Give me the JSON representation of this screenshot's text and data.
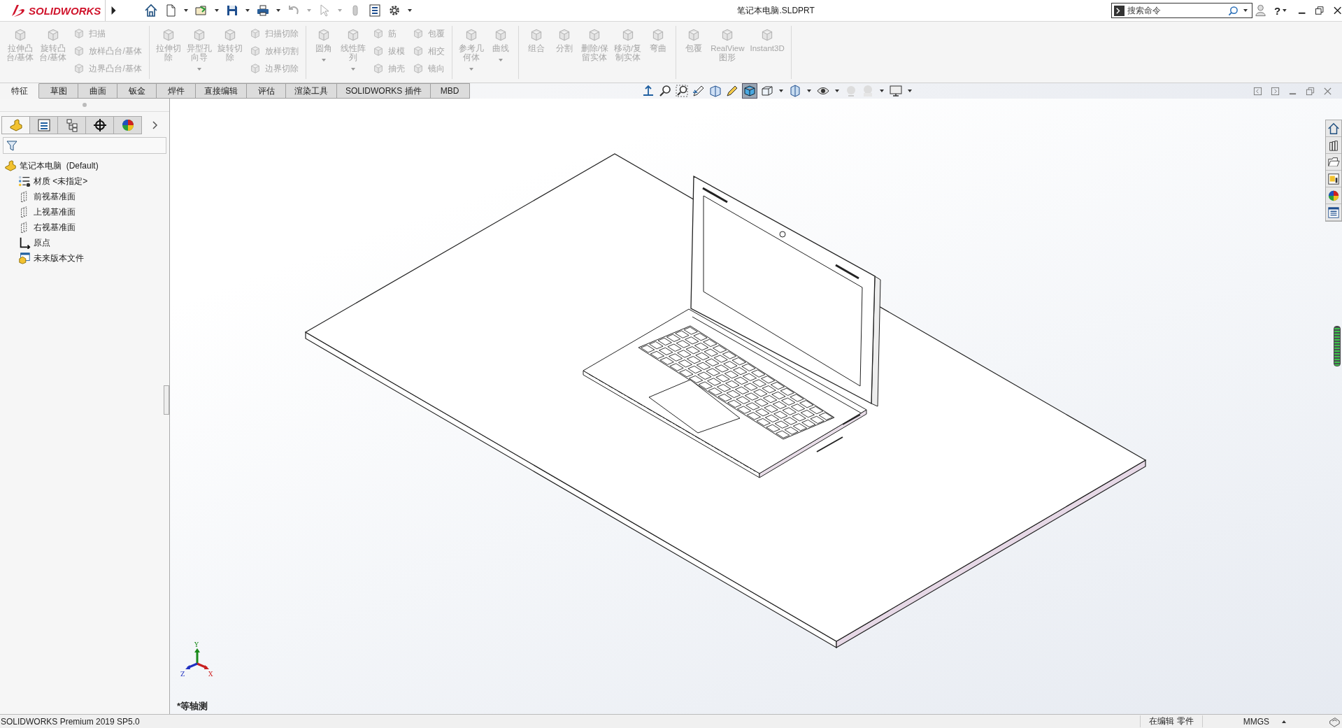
{
  "app": {
    "logo": "SOLIDWORKS",
    "title": "笔记本电脑.SLDPRT",
    "search": {
      "placeholder": "搜索命令"
    },
    "help": "?"
  },
  "ribbon": {
    "groups": [
      {
        "items": [
          {
            "kind": "large",
            "lines": [
              "拉伸凸",
              "台/基体"
            ],
            "disabled": true,
            "menu": false
          },
          {
            "kind": "large",
            "lines": [
              "旋转凸",
              "台/基体"
            ],
            "disabled": true,
            "menu": false
          },
          {
            "kind": "stack",
            "tools": [
              {
                "label": "扫描",
                "disabled": true
              },
              {
                "label": "放样凸台/基体",
                "disabled": true
              },
              {
                "label": "边界凸台/基体",
                "disabled": true
              }
            ]
          }
        ]
      },
      {
        "items": [
          {
            "kind": "large",
            "lines": [
              "拉伸切",
              "除"
            ],
            "disabled": true,
            "menu": false
          },
          {
            "kind": "large",
            "lines": [
              "异型孔",
              "向导"
            ],
            "disabled": true,
            "menu": true
          },
          {
            "kind": "large",
            "lines": [
              "旋转切",
              "除"
            ],
            "disabled": true,
            "menu": false
          },
          {
            "kind": "stack",
            "tools": [
              {
                "label": "扫描切除",
                "disabled": true
              },
              {
                "label": "放样切割",
                "disabled": true
              },
              {
                "label": "边界切除",
                "disabled": true
              }
            ]
          }
        ]
      },
      {
        "items": [
          {
            "kind": "large",
            "lines": [
              "圆角"
            ],
            "disabled": true,
            "menu": true
          },
          {
            "kind": "large",
            "lines": [
              "线性阵",
              "列"
            ],
            "disabled": true,
            "menu": true
          },
          {
            "kind": "stack",
            "tools": [
              {
                "label": "筋",
                "disabled": true
              },
              {
                "label": "拔模",
                "disabled": true
              },
              {
                "label": "抽壳",
                "disabled": true
              }
            ]
          },
          {
            "kind": "stack",
            "tools": [
              {
                "label": "包覆",
                "disabled": true
              },
              {
                "label": "相交",
                "disabled": true
              },
              {
                "label": "镜向",
                "disabled": true
              }
            ]
          }
        ]
      },
      {
        "items": [
          {
            "kind": "large",
            "lines": [
              "参考几",
              "何体"
            ],
            "disabled": true,
            "menu": true
          },
          {
            "kind": "large",
            "lines": [
              "曲线"
            ],
            "disabled": true,
            "menu": true
          }
        ]
      },
      {
        "items": [
          {
            "kind": "large",
            "lines": [
              "组合"
            ],
            "disabled": true,
            "menu": false
          },
          {
            "kind": "large",
            "lines": [
              "分割"
            ],
            "disabled": true,
            "menu": false
          },
          {
            "kind": "large",
            "lines": [
              "删除/保",
              "留实体"
            ],
            "disabled": true,
            "menu": false
          },
          {
            "kind": "large",
            "lines": [
              "移动/复",
              "制实体"
            ],
            "disabled": true,
            "menu": false
          },
          {
            "kind": "large",
            "lines": [
              "弯曲"
            ],
            "disabled": true,
            "menu": false
          }
        ]
      },
      {
        "items": [
          {
            "kind": "large",
            "lines": [
              "包覆"
            ],
            "disabled": true,
            "menu": false
          },
          {
            "kind": "large",
            "lines": [
              "RealView",
              "图形"
            ],
            "disabled": true,
            "menu": false
          },
          {
            "kind": "large",
            "lines": [
              "Instant3D"
            ],
            "disabled": true,
            "menu": false
          }
        ]
      }
    ]
  },
  "tabs": [
    {
      "label": "特征",
      "selected": true
    },
    {
      "label": "草图",
      "selected": false
    },
    {
      "label": "曲面",
      "selected": false
    },
    {
      "label": "钣金",
      "selected": false
    },
    {
      "label": "焊件",
      "selected": false
    },
    {
      "label": "直接编辑",
      "selected": false
    },
    {
      "label": "评估",
      "selected": false
    },
    {
      "label": "渲染工具",
      "selected": false
    },
    {
      "label": "SOLIDWORKS 插件",
      "selected": false
    },
    {
      "label": "MBD",
      "selected": false
    }
  ],
  "panel_tabs": [
    {
      "selected": true
    },
    {
      "selected": false
    },
    {
      "selected": false
    },
    {
      "selected": false
    },
    {
      "selected": false
    }
  ],
  "tree": {
    "label": "笔记本电脑  (Default)",
    "kind": "part",
    "children": [
      {
        "label": "材质 <未指定>",
        "kind": "material"
      },
      {
        "label": "前视基准面",
        "kind": "plane"
      },
      {
        "label": "上视基准面",
        "kind": "plane"
      },
      {
        "label": "右视基准面",
        "kind": "plane"
      },
      {
        "label": "原点",
        "kind": "origin"
      },
      {
        "label": "未来版本文件",
        "kind": "history"
      }
    ]
  },
  "viewport": {
    "triad": {
      "x": "X",
      "y": "Y",
      "z": "Z"
    },
    "view_name": "*等轴测"
  },
  "status_bar": {
    "product": "SOLIDWORKS Premium 2019 SP5.0",
    "mode": "在编辑 零件",
    "units": "MMGS"
  }
}
